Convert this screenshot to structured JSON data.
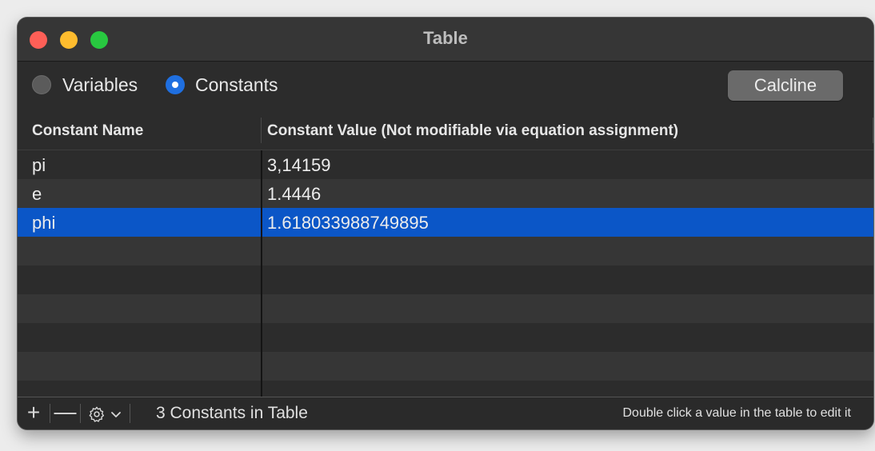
{
  "window": {
    "title": "Table"
  },
  "toolbar": {
    "radio_variables_label": "Variables",
    "radio_constants_label": "Constants",
    "selected_mode": "Constants",
    "calcline_button_label": "Calcline"
  },
  "table": {
    "columns": [
      "Constant Name",
      "Constant Value  (Not modifiable via equation assignment)"
    ],
    "rows": [
      {
        "name": "pi",
        "value": "3,14159"
      },
      {
        "name": "e",
        "value": "1.4446"
      },
      {
        "name": "phi",
        "value": "1.618033988749895",
        "selected": true
      }
    ]
  },
  "footer": {
    "add_button": "+",
    "remove_button": "—",
    "gear_icon": "gear-icon",
    "status_count": "3 Constants in Table",
    "hint": "Double click a value in the table to edit it"
  },
  "colors": {
    "selection": "#0b56c7",
    "radio_on": "#1f6fe0",
    "close": "#fe5f57",
    "minimize": "#febc2e",
    "maximize": "#28c840"
  }
}
